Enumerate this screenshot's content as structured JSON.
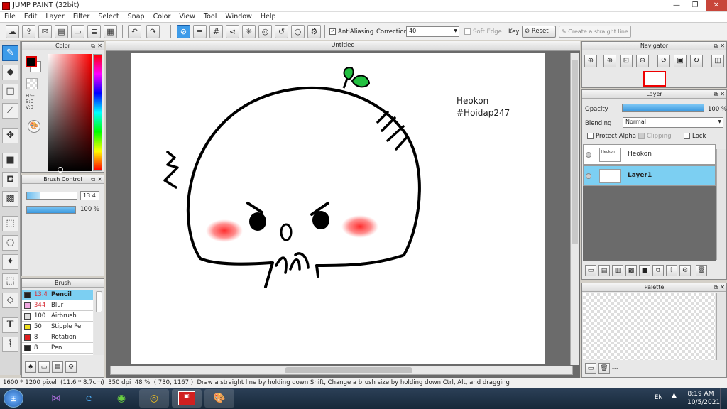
{
  "window": {
    "title": "JUMP PAINT (32bit)",
    "min": "—",
    "max": "❐",
    "close": "✕"
  },
  "menu": [
    "File",
    "Edit",
    "Layer",
    "Filter",
    "Select",
    "Snap",
    "Color",
    "View",
    "Tool",
    "Window",
    "Help"
  ],
  "toolbar": {
    "antialiasing_label": "AntiAliasing",
    "correction_label": "Correction",
    "correction_value": "40",
    "soft_edge_label": "Soft Edge",
    "key_label": "Key",
    "reset_label": "Reset",
    "straight_line_label": "Create a straight line"
  },
  "color_panel": {
    "title": "Color",
    "h": "H:--",
    "s": "S:0",
    "v": "V:0",
    "fg": "#000000",
    "bg": "#ffffff"
  },
  "brush_control": {
    "title": "Brush Control",
    "size": "13.4",
    "opacity": "100 %"
  },
  "brush_panel": {
    "title": "Brush",
    "items": [
      {
        "size": "13.4",
        "name": "Pencil",
        "color": "#222222",
        "selected": true,
        "size_color": "#d8303a"
      },
      {
        "size": "344",
        "name": "Blur",
        "color": "#f0a8e0",
        "selected": false,
        "size_color": "#d8303a"
      },
      {
        "size": "100",
        "name": "Airbrush",
        "color": "#dddddd",
        "selected": false,
        "size_color": "#222222"
      },
      {
        "size": "50",
        "name": "Stipple Pen",
        "color": "#f0e020",
        "selected": false,
        "size_color": "#222222"
      },
      {
        "size": "8",
        "name": "Rotation Symm",
        "color": "#e02020",
        "selected": false,
        "size_color": "#222222"
      },
      {
        "size": "8",
        "name": "Pen",
        "color": "#222222",
        "selected": false,
        "size_color": "#222222"
      }
    ]
  },
  "canvas": {
    "tab": "Untitled",
    "text_line1": "Heokon",
    "text_line2": "#Hoidap247"
  },
  "navigator": {
    "title": "Navigator"
  },
  "layer_panel": {
    "title": "Layer",
    "opacity_label": "Opacity",
    "opacity_value": "100 %",
    "blending_label": "Blending",
    "blending_value": "Normal",
    "protect_alpha": "Protect Alpha",
    "clipping": "Clipping",
    "lock": "Lock",
    "layers": [
      {
        "name": "Heokon",
        "selected": false
      },
      {
        "name": "Layer1",
        "selected": true
      }
    ]
  },
  "palette": {
    "title": "Palette",
    "dash": "---"
  },
  "status": {
    "pixel": "1600 * 1200 pixel",
    "cm": "(11.6 * 8.7cm)",
    "dpi": "350 dpi",
    "zoom": "48 %",
    "coords": "( 730, 1167 )",
    "hint": "Draw a straight line by holding down Shift, Change a brush size by holding down Ctrl, Alt, and dragging"
  },
  "taskbar": {
    "lang": "EN",
    "time": "8:19 AM",
    "date": "10/5/2021"
  }
}
